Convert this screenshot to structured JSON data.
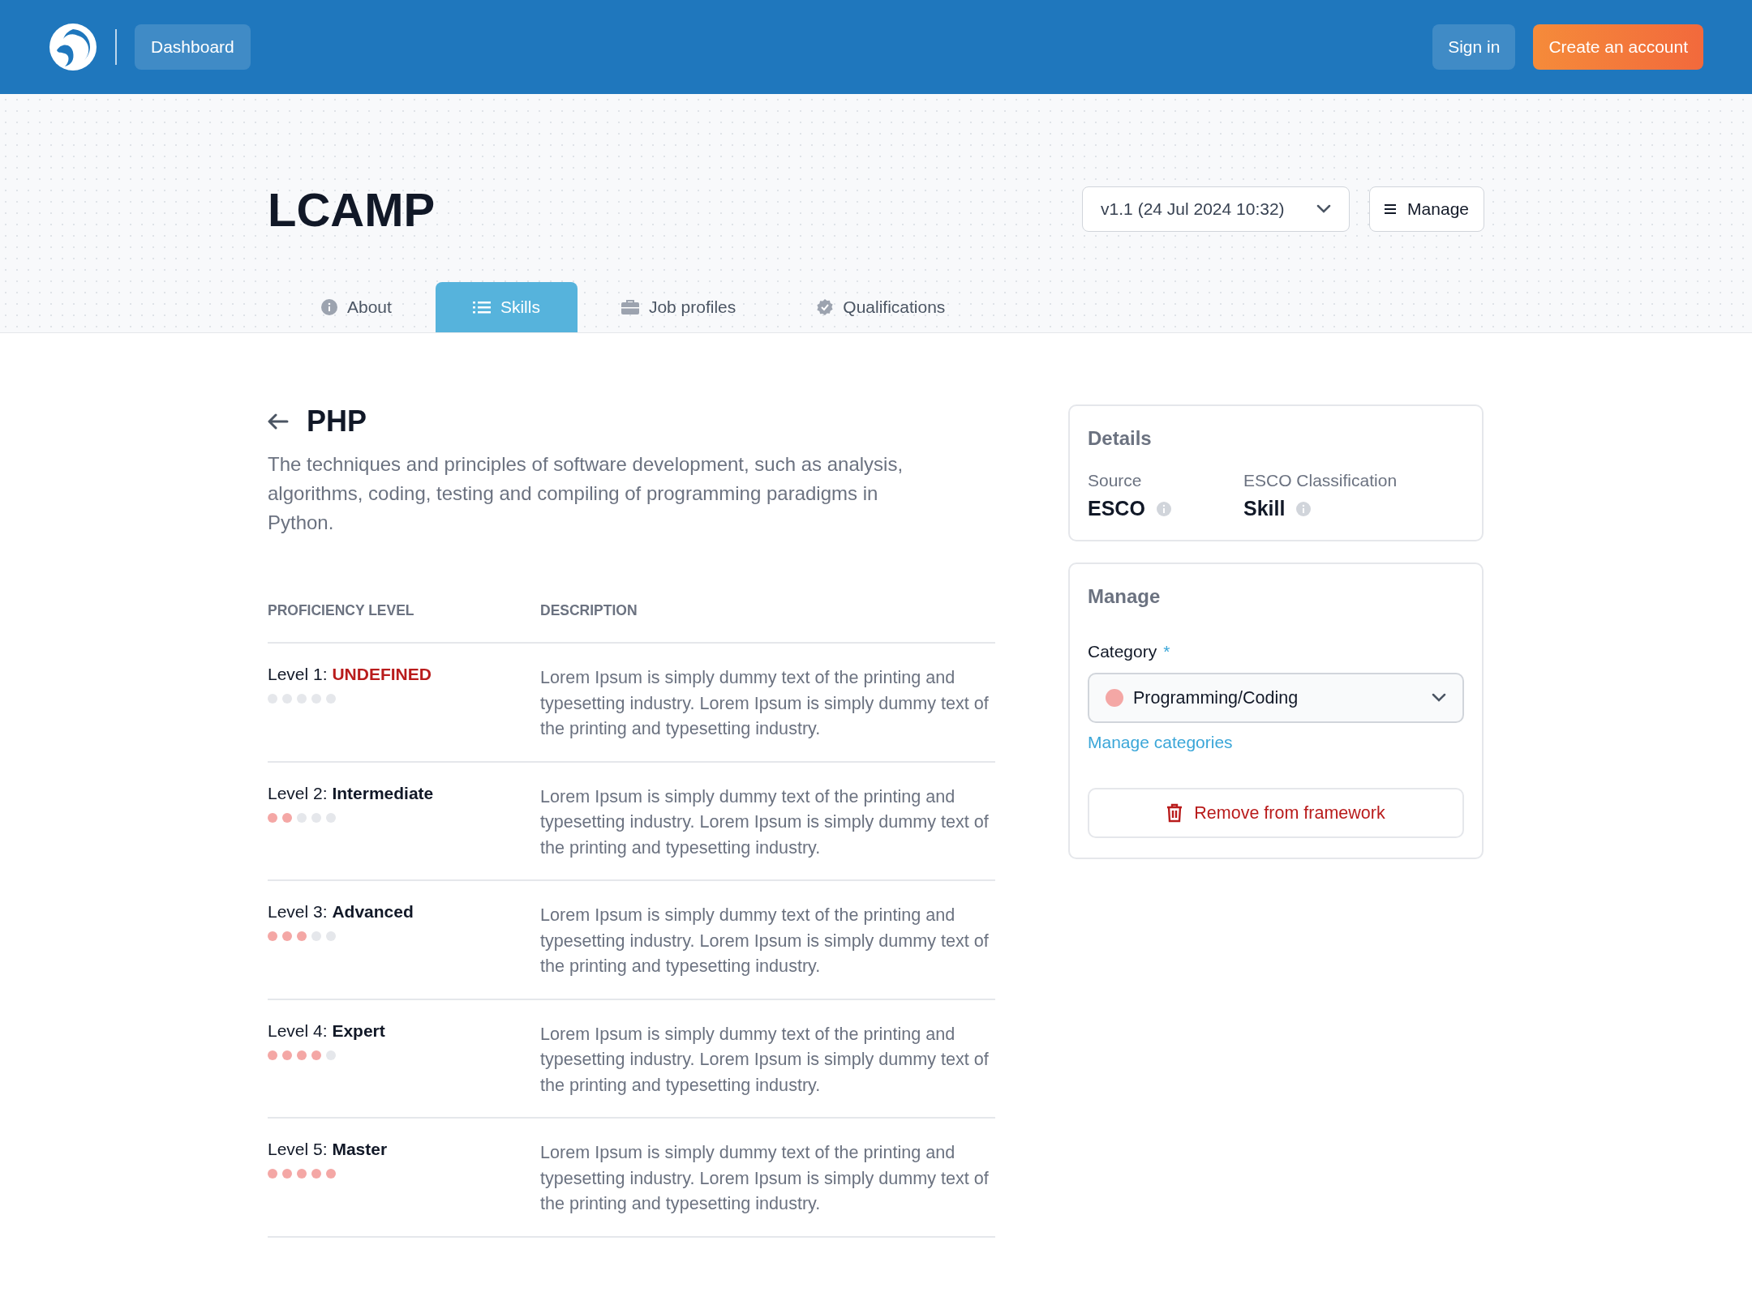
{
  "header": {
    "nav": [
      {
        "label": "Dashboard"
      }
    ],
    "actions": [
      {
        "label": "Sign in",
        "kind": "secondary"
      },
      {
        "label": "Create an account",
        "kind": "primary"
      }
    ]
  },
  "title": "LCAMP",
  "version_select": {
    "value": "v1.1 (24 Jul 2024 10:32)"
  },
  "manage_button": {
    "label": "Manage"
  },
  "tabs": [
    {
      "label": "About",
      "kind": "info",
      "selected": false
    },
    {
      "label": "Skills",
      "kind": "list",
      "selected": true
    },
    {
      "label": "Job profiles",
      "kind": "briefcase",
      "selected": false
    },
    {
      "label": "Qualifications",
      "kind": "badge",
      "selected": false
    }
  ],
  "skill": {
    "name": "PHP",
    "description": "The techniques and principles of software development, such as analysis, algorithms, coding, testing and compiling of programming paradigms in Python."
  },
  "table": {
    "columns": [
      "PROFICIENCY LEVEL",
      "DESCRIPTION"
    ],
    "rows": [
      {
        "prefix": "Level 1:",
        "name": "UNDEFINED",
        "kind": "undefined",
        "stars": 0,
        "description": "Lorem Ipsum is simply dummy text of the printing and typesetting industry. Lorem Ipsum is simply dummy text of the printing and typesetting industry."
      },
      {
        "prefix": "Level 2:",
        "name": "Intermediate",
        "kind": "defined",
        "stars": 2,
        "description": "Lorem Ipsum is simply dummy text of the printing and typesetting industry. Lorem Ipsum is simply dummy text of the printing and typesetting industry."
      },
      {
        "prefix": "Level 3:",
        "name": "Advanced",
        "kind": "defined",
        "stars": 3,
        "description": "Lorem Ipsum is simply dummy text of the printing and typesetting industry. Lorem Ipsum is simply dummy text of the printing and typesetting industry."
      },
      {
        "prefix": "Level 4:",
        "name": "Expert",
        "kind": "defined",
        "stars": 4,
        "description": "Lorem Ipsum is simply dummy text of the printing and typesetting industry. Lorem Ipsum is simply dummy text of the printing and typesetting industry."
      },
      {
        "prefix": "Level 5:",
        "name": "Master",
        "kind": "defined",
        "stars": 5,
        "description": "Lorem Ipsum is simply dummy text of the printing and typesetting industry. Lorem Ipsum is simply dummy text of the printing and typesetting industry."
      }
    ]
  },
  "details": {
    "title": "Details",
    "fields": [
      {
        "label": "Source",
        "value": "ESCO"
      },
      {
        "label": "ESCO Classification",
        "value": "Skill"
      }
    ]
  },
  "manage": {
    "title": "Manage",
    "category_label": "Category",
    "required_mark": "*",
    "category": {
      "value": "Programming/Coding",
      "color": "#f4a7a5"
    },
    "link": "Manage categories",
    "remove_button": "Remove from framework"
  }
}
